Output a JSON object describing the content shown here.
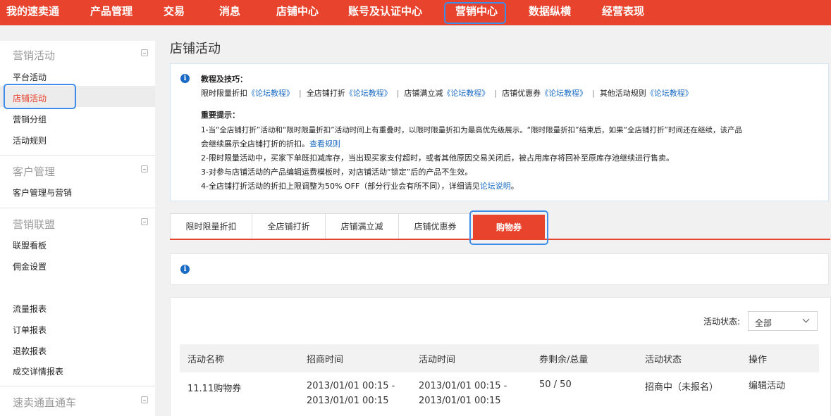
{
  "topnav": {
    "items": [
      "我的速卖通",
      "产品管理",
      "交易",
      "消息",
      "店铺中心",
      "账号及认证中心",
      "营销中心",
      "数据纵横",
      "经营表现"
    ]
  },
  "sidebar": {
    "sections": [
      {
        "title": "营销活动",
        "items": [
          "平台活动",
          "店铺活动",
          "营销分组",
          "活动规则"
        ]
      },
      {
        "title": "客户管理",
        "items": [
          "客户管理与营销"
        ]
      },
      {
        "title": "营销联盟",
        "items": [
          "联盟看板",
          "佣金设置"
        ]
      },
      {
        "title": "",
        "items": [
          "流量报表",
          "订单报表",
          "退款报表",
          "成交详情报表"
        ]
      },
      {
        "title": "速卖通直通车",
        "items": []
      }
    ]
  },
  "page": {
    "title": "店铺活动"
  },
  "info": {
    "tips_title": "教程及技巧：",
    "tips": [
      {
        "label": "限时限量折扣",
        "link": "《论坛教程》"
      },
      {
        "label": "全店铺打折",
        "link": "《论坛教程》"
      },
      {
        "label": "店铺满立减",
        "link": "《论坛教程》"
      },
      {
        "label": "店铺优惠券",
        "link": "《论坛教程》"
      },
      {
        "label": "其他活动规则",
        "link": "《论坛教程》"
      }
    ],
    "notice_title": "重要提示：",
    "notice1a": "1-当“全店铺打折”活动和“限时限量折扣”活动时间上有重叠时，以限时限量折扣为最高优先级展示。“限时限量折扣”结束后，如果“全店铺打折”时间还在继续，该产品",
    "notice1b": "会继续展示全店铺打折的折扣。",
    "notice1b_link": "查看规则",
    "notice2": "2-限时限量活动中，买家下单既扣减库存，当出现买家支付超时，或者其他原因交易关闭后，被占用库存将回补至原库存池继续进行售卖。",
    "notice3": "3-对参与店铺活动的产品编辑运费模板时，对店铺活动“锁定”后的产品不生效。",
    "notice4": "4-全店铺打折活动的折扣上限调整为50% OFF（部分行业会有所不同），详细请见",
    "notice4_link": "论坛说明",
    "notice4_end": "。"
  },
  "tabs": [
    "限时限量折扣",
    "全店铺打折",
    "店铺满立减",
    "店铺优惠券",
    "购物券"
  ],
  "filter": {
    "label": "活动状态:",
    "value": "全部"
  },
  "table": {
    "headers": [
      "活动名称",
      "招商时间",
      "活动时间",
      "券剩余/总量",
      "活动状态",
      "操作"
    ],
    "rows": [
      {
        "name": "11.11购物券",
        "recruit_time_1": "2013/01/01 00:15 -",
        "recruit_time_2": "2013/01/01 00:15",
        "activity_time_1": "2013/01/01 00:15 -",
        "activity_time_2": "2013/01/01 00:15",
        "quota": "50 / 50",
        "status": "招商中（未报名）",
        "action": "编辑活动"
      }
    ]
  },
  "colors": {
    "brand": "#e8442d",
    "link": "#1a6bc4",
    "highlight": "#3d8de8"
  }
}
